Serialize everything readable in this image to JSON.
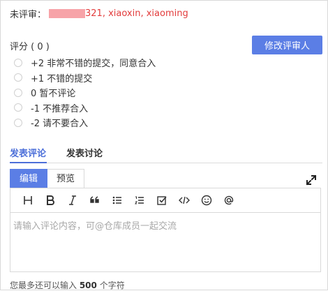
{
  "reviewers": {
    "label": "未评审：",
    "names": "321, xiaoxin, xiaoming"
  },
  "rating": {
    "title": "评分 ( 0 )",
    "edit_button": "修改评审人",
    "options": [
      {
        "label": "+2 非常不错的提交，同意合入"
      },
      {
        "label": "+1 不错的提交"
      },
      {
        "label": "0 暂不评论"
      },
      {
        "label": "-1 不推荐合入"
      },
      {
        "label": "-2 请不要合入"
      }
    ]
  },
  "tabs": {
    "comment": "发表评论",
    "discussion": "发表讨论"
  },
  "editor": {
    "edit_tab": "编辑",
    "preview_tab": "预览",
    "placeholder": "请输入评论内容，可@仓库成员一起交流",
    "counter_prefix": "您最多还可以输入 ",
    "counter_value": "500",
    "counter_suffix": " 个字符",
    "toolbar_icons": [
      "heading-icon",
      "bold-icon",
      "italic-icon",
      "quote-icon",
      "unordered-list-icon",
      "ordered-list-icon",
      "task-list-icon",
      "code-icon",
      "emoji-icon",
      "mention-icon"
    ]
  },
  "colors": {
    "accent": "#5b7ee5",
    "tab_active": "#4c6fd9",
    "reviewer_names": "#e23c3c"
  }
}
